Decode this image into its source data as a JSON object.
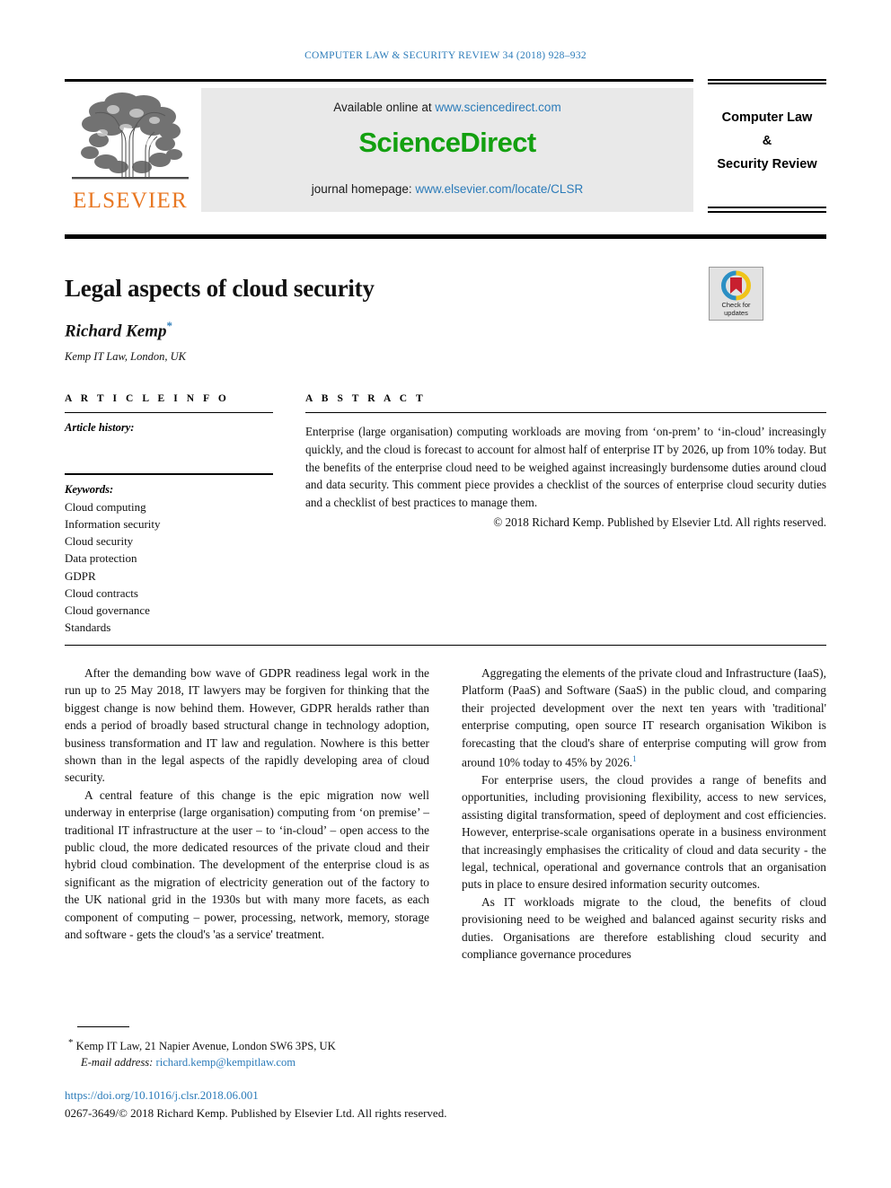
{
  "running_head": "COMPUTER LAW & SECURITY REVIEW 34 (2018) 928–932",
  "masthead": {
    "publisher_logo_text": "ELSEVIER",
    "available_online_prefix": "Available online at ",
    "available_online_link": "www.sciencedirect.com",
    "sciencedirect_logo": "ScienceDirect",
    "homepage_prefix": "journal homepage: ",
    "homepage_link": "www.elsevier.com/locate/CLSR",
    "journal_title_line1": "Computer Law",
    "journal_title_line2": "&",
    "journal_title_line3": "Security Review"
  },
  "article": {
    "title": "Legal aspects of cloud security",
    "author": "Richard Kemp",
    "author_footnote_marker": "*",
    "affiliation": "Kemp IT Law, London, UK"
  },
  "crossmark": {
    "line1": "Check for",
    "line2": "updates"
  },
  "article_info": {
    "heading": "A R T I C L E   I N F O",
    "history_label": "Article history:",
    "keywords_label": "Keywords:",
    "keywords": [
      "Cloud computing",
      "Information security",
      "Cloud security",
      "Data protection",
      "GDPR",
      "Cloud contracts",
      "Cloud governance",
      "Standards"
    ]
  },
  "abstract": {
    "heading": "A B S T R A C T",
    "text": "Enterprise (large organisation) computing workloads are moving from ‘on-prem’ to ‘in-cloud’ increasingly quickly, and the cloud is forecast to account for almost half of enterprise IT by 2026, up from 10% today. But the benefits of the enterprise cloud need to be weighed against increasingly burdensome duties around cloud and data security. This comment piece provides a checklist of the sources of enterprise cloud security duties and a checklist of best practices to manage them.",
    "copyright": "© 2018 Richard Kemp. Published by Elsevier Ltd. All rights reserved."
  },
  "body": {
    "left_column": [
      "After the demanding bow wave of GDPR readiness legal work in the run up to 25 May 2018, IT lawyers may be forgiven for thinking that the biggest change is now behind them. However, GDPR heralds rather than ends a period of broadly based structural change in technology adoption, business transformation and IT law and regulation. Nowhere is this better shown than in the legal aspects of the rapidly developing area of cloud security.",
      "A central feature of this change is the epic migration now well underway in enterprise (large organisation) computing from ‘on premise’ – traditional IT infrastructure at the user – to ‘in-cloud’ – open access to the public cloud, the more dedicated resources of the private cloud and their hybrid cloud combination. The development of the enterprise cloud is as significant as the migration of electricity generation out of the factory to the UK national grid in the 1930s but with many more facets, as each component of computing – power, processing, network, memory, storage and software - gets the cloud's 'as a service' treatment."
    ],
    "right_column_p1_pre": "Aggregating the elements of the private cloud and Infrastructure (IaaS), Platform (PaaS) and Software (SaaS) in the public cloud, and comparing their projected development over the next ten years with 'traditional' enterprise computing, open source IT research organisation Wikibon is forecasting that the cloud's share of enterprise computing will grow from around 10% today to 45% by 2026.",
    "right_column_p1_ref": "1",
    "right_column_rest": [
      "For enterprise users, the cloud provides a range of benefits and opportunities, including provisioning flexibility, access to new services, assisting digital transformation, speed of deployment and cost efficiencies. However, enterprise-scale organisations operate in a business environment that increasingly emphasises the criticality of cloud and data security - the legal, technical, operational and governance controls that an organisation puts in place to ensure desired information security outcomes.",
      "As IT workloads migrate to the cloud, the benefits of cloud provisioning need to be weighed and balanced against security risks and duties. Organisations are therefore establishing cloud security and compliance governance procedures"
    ]
  },
  "footer": {
    "footnote_marker": "*",
    "footnote_address": "Kemp IT Law, 21 Napier Avenue, London SW6 3PS, UK",
    "email_label": "E-mail address:",
    "email": "richard.kemp@kempitlaw.com",
    "doi": "https://doi.org/10.1016/j.clsr.2018.06.001",
    "issn_line": "0267-3649/© 2018 Richard Kemp. Published by Elsevier Ltd. All rights reserved."
  },
  "colors": {
    "link": "#2b7bb9",
    "sciencedirect_green": "#13a010",
    "elsevier_orange": "#E87722",
    "crossmark_red": "#c8202f",
    "crossmark_yellow": "#f0c419",
    "crossmark_blue": "#2b8fc4"
  }
}
